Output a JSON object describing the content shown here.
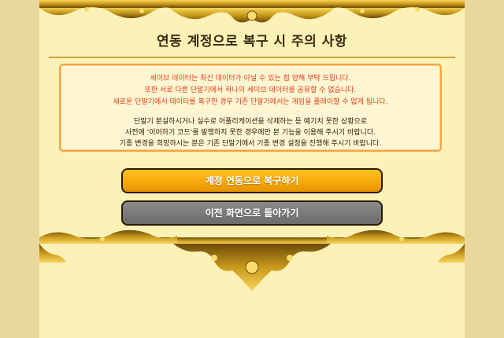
{
  "title": "연동 계정으로 복구 시 주의 사항",
  "notice": {
    "warnings": [
      "세이브 데이터는 최신 데이터가 아닐 수 있는 점 양해 부탁 드립니다.",
      "또한 서로 다른 단말기에서 하나의 세이브 데이터를 공유할 수 없습니다.",
      "새로운 단말기에서 데이터를 복구한 경우 기존 단말기에서는 게임을 플레이할 수 없게 됩니다."
    ],
    "info": [
      "단말기 분실하시거나 실수로 어플리케이션을 삭제하는 등 예기치 못한 상황으로",
      "사전에 '이어하기 코드'를 발행하지 못한 경우에만 본 기능을 이용해 주시기 바랍니다.",
      "기종 변경을 희망하시는 분은 기존 단말기에서 기종 변경 설정을 진행해 주시기 바랍니다."
    ]
  },
  "buttons": {
    "restore_label": "계정 연동으로 복구하기",
    "back_label": "이전 화면으로 돌아가기"
  },
  "colors": {
    "panel_bg": "#fdf1b8",
    "warning_text": "#e23a1c",
    "restore_button": "#f5a90b",
    "back_button": "#7a7a7a",
    "ornament_gold": "#c99a1c"
  }
}
